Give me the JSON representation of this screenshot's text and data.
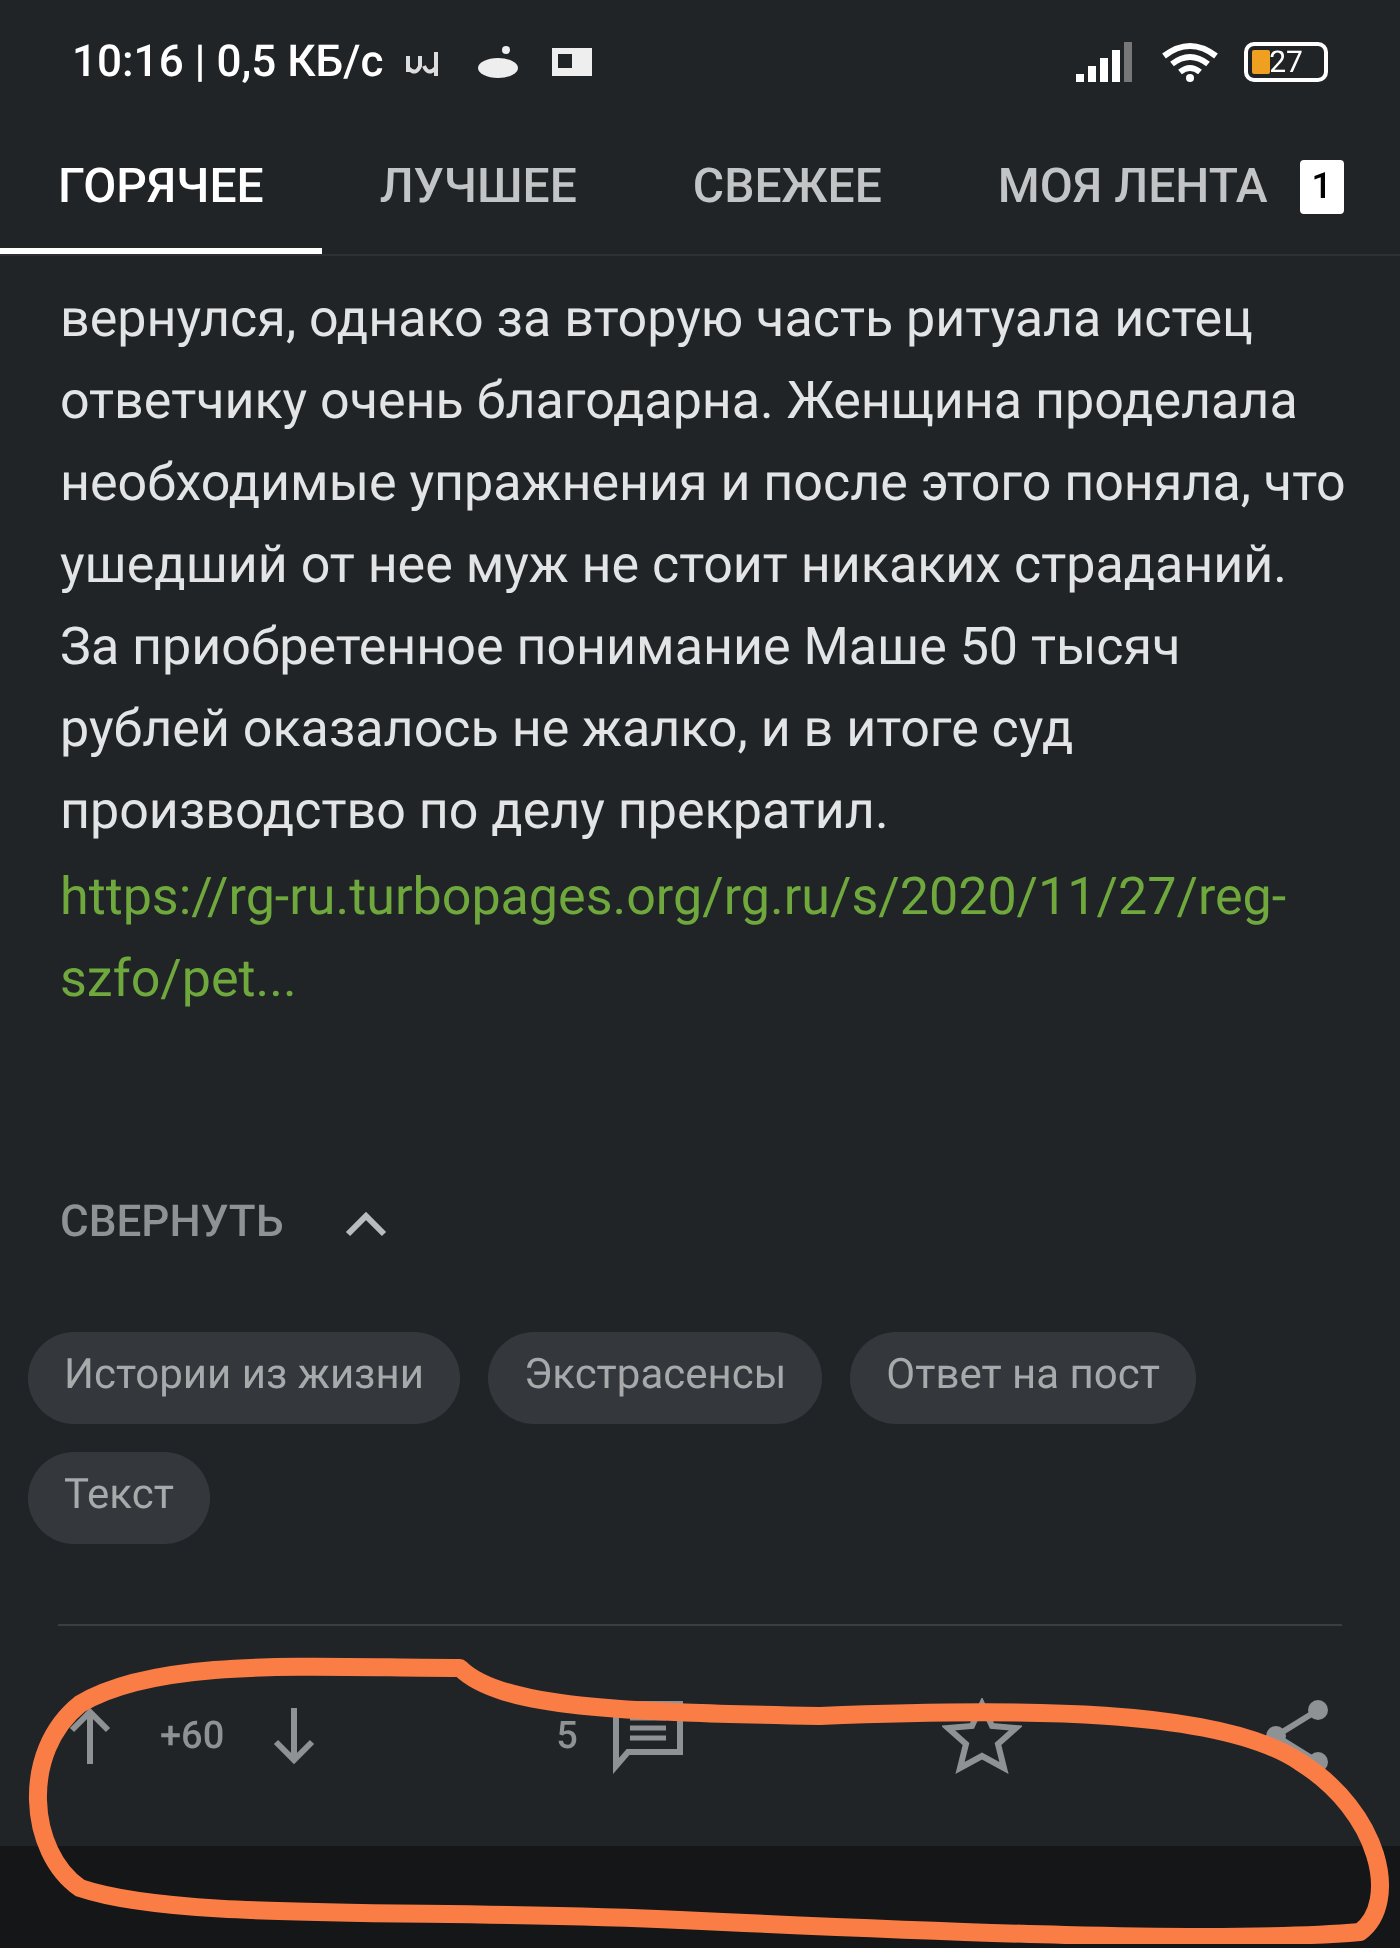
{
  "status_bar": {
    "time": "10:16 | 0,5 КБ/с",
    "battery": "27"
  },
  "tabs": [
    {
      "label": "ГОРЯЧЕЕ",
      "selected": true
    },
    {
      "label": "ЛУЧШЕЕ",
      "selected": false
    },
    {
      "label": "СВЕЖЕЕ",
      "selected": false
    },
    {
      "label": "МОЯ ЛЕНТА",
      "selected": false,
      "badge": "1"
    }
  ],
  "post": {
    "text": "вернулся, однако за вторую часть ритуала истец ответчику очень благодарна. Женщина проделала необходимые упражнения и после этого поняла, что ушедший от нее муж не стоит никаких страданий. За приобретенное понимание Маше 50 тысяч рублей оказалось не жалко, и в итоге суд производство по делу прекратил.",
    "link": "https://rg-ru.turbopages.org/rg.ru/s/2020/11/27/reg-szfo/pet...",
    "collapse": "СВЕРНУТЬ",
    "tags": [
      "Истории из жизни",
      "Экстрасенсы",
      "Ответ на пост",
      "Текст"
    ]
  },
  "actions": {
    "rating": "+60",
    "comments": "5"
  }
}
